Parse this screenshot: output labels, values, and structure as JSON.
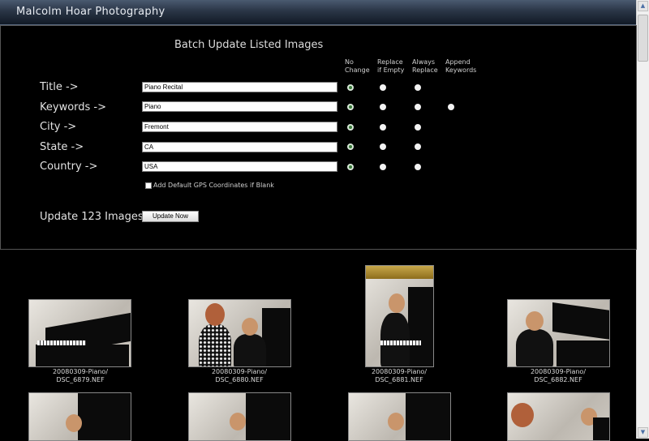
{
  "app": {
    "title": "Malcolm Hoar Photography"
  },
  "batch": {
    "title": "Batch Update Listed Images",
    "columns": {
      "no_change": {
        "line1": "No",
        "line2": "Change"
      },
      "replace_if_empty": {
        "line1": "Replace",
        "line2": "if Empty"
      },
      "always_replace": {
        "line1": "Always",
        "line2": "Replace"
      },
      "append_keywords": {
        "line1": "Append",
        "line2": "Keywords"
      }
    },
    "fields": {
      "title": {
        "label": "Title ->",
        "value": "Piano Recital"
      },
      "keywords": {
        "label": "Keywords ->",
        "value": "Piano"
      },
      "city": {
        "label": "City ->",
        "value": "Fremont"
      },
      "state": {
        "label": "State ->",
        "value": "CA"
      },
      "country": {
        "label": "Country ->",
        "value": "USA"
      }
    },
    "gps_checkbox_label": "Add Default GPS Coordinates if Blank",
    "update_label": "Update 123 Images",
    "update_button": "Update Now"
  },
  "gallery": {
    "items": [
      {
        "path": "20080309-Piano/",
        "file": "DSC_6879.NEF"
      },
      {
        "path": "20080309-Piano/",
        "file": "DSC_6880.NEF"
      },
      {
        "path": "20080309-Piano/",
        "file": "DSC_6881.NEF"
      },
      {
        "path": "20080309-Piano/",
        "file": "DSC_6882.NEF"
      }
    ]
  }
}
